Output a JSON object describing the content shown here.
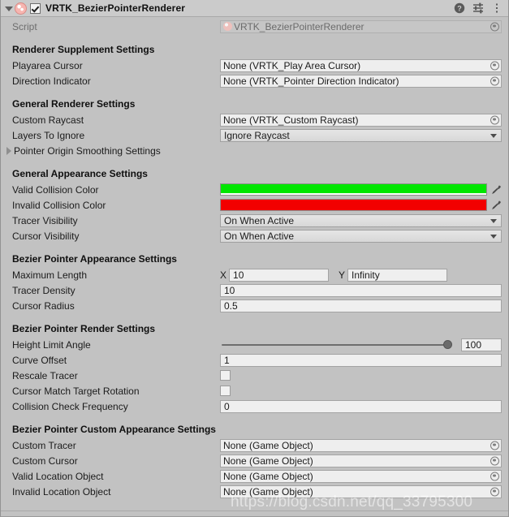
{
  "header": {
    "title": "VRTK_BezierPointerRenderer",
    "enabled": true,
    "foldout_icon": "triangle-down-icon",
    "component_icon": "script-icon",
    "help_icon": "help-icon",
    "preset_icon": "preset-sliders-icon",
    "menu_icon": "kebab-menu-icon"
  },
  "script_row": {
    "label": "Script",
    "value": "VRTK_BezierPointerRenderer"
  },
  "sections": [
    {
      "title": "Renderer Supplement Settings",
      "rows": [
        {
          "label": "Playarea Cursor",
          "type": "object",
          "value": "None (VRTK_Play Area Cursor)"
        },
        {
          "label": "Direction Indicator",
          "type": "object",
          "value": "None (VRTK_Pointer Direction Indicator)"
        }
      ]
    },
    {
      "title": "General Renderer Settings",
      "rows": [
        {
          "label": "Custom Raycast",
          "type": "object",
          "value": "None (VRTK_Custom Raycast)"
        },
        {
          "label": "Layers To Ignore",
          "type": "dropdown",
          "value": "Ignore Raycast"
        },
        {
          "label": "Pointer Origin Smoothing Settings",
          "type": "foldout",
          "value": ""
        }
      ]
    },
    {
      "title": "General Appearance Settings",
      "rows": [
        {
          "label": "Valid Collision Color",
          "type": "color",
          "value": "#00e600",
          "alpha": "#ffffff"
        },
        {
          "label": "Invalid Collision Color",
          "type": "color",
          "value": "#f20000",
          "alpha": "#f20000"
        },
        {
          "label": "Tracer Visibility",
          "type": "dropdown",
          "value": "On When Active"
        },
        {
          "label": "Cursor Visibility",
          "type": "dropdown",
          "value": "On When Active"
        }
      ]
    },
    {
      "title": "Bezier Pointer Appearance Settings",
      "rows": [
        {
          "label": "Maximum Length",
          "type": "vector2",
          "x_label": "X",
          "x_value": "10",
          "y_label": "Y",
          "y_value": "Infinity"
        },
        {
          "label": "Tracer Density",
          "type": "text",
          "value": "10"
        },
        {
          "label": "Cursor Radius",
          "type": "text",
          "value": "0.5"
        }
      ]
    },
    {
      "title": "Bezier Pointer Render Settings",
      "rows": [
        {
          "label": "Height Limit Angle",
          "type": "slider",
          "value": "100",
          "percent": 100
        },
        {
          "label": "Curve Offset",
          "type": "text",
          "value": "1"
        },
        {
          "label": "Rescale Tracer",
          "type": "checkbox",
          "value": false
        },
        {
          "label": "Cursor Match Target Rotation",
          "type": "checkbox",
          "value": false
        },
        {
          "label": "Collision Check Frequency",
          "type": "text",
          "value": "0"
        }
      ]
    },
    {
      "title": "Bezier Pointer Custom Appearance Settings",
      "rows": [
        {
          "label": "Custom Tracer",
          "type": "object",
          "value": "None (Game Object)"
        },
        {
          "label": "Custom Cursor",
          "type": "object",
          "value": "None (Game Object)"
        },
        {
          "label": "Valid Location Object",
          "type": "object",
          "value": "None (Game Object)"
        },
        {
          "label": "Invalid Location Object",
          "type": "object",
          "value": "None (Game Object)"
        }
      ]
    }
  ],
  "watermark": {
    "text": "https://blog.csdn.net/qq_33795300"
  },
  "colors": {
    "panel_bg": "#c2c2c2",
    "header_bg": "#cbcbcb",
    "field_bg": "#eeeeee",
    "valid_collision": "#00e600",
    "invalid_collision": "#f20000"
  }
}
